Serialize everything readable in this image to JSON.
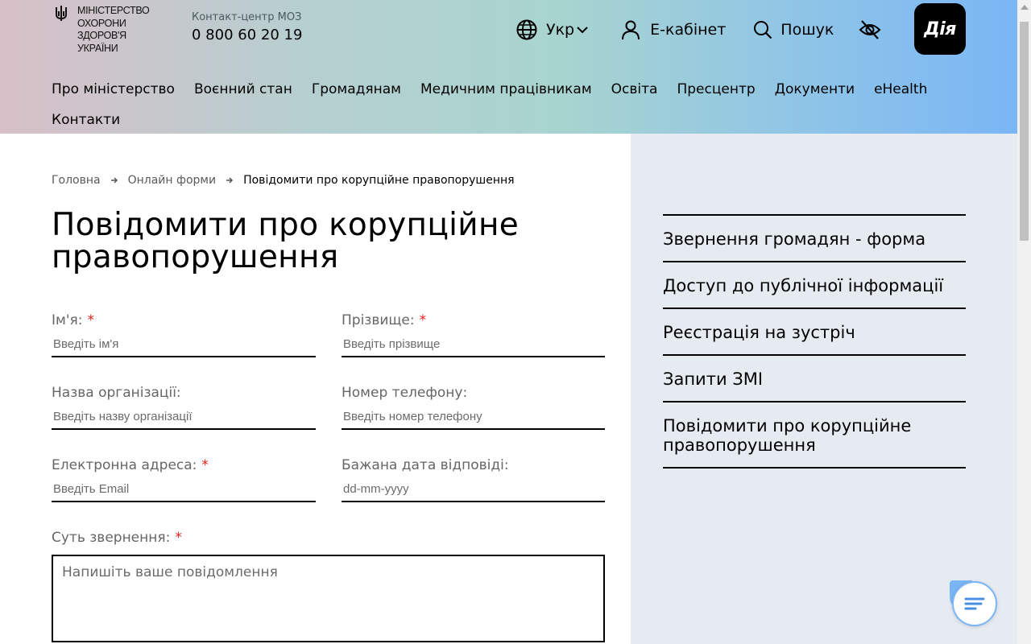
{
  "header": {
    "logo_lines": [
      "Міністерство",
      "охорони",
      "здоров'я",
      "України"
    ],
    "contact_label": "Контакт-центр МОЗ",
    "contact_phone": "0 800 60 20 19",
    "language_label": "Укр",
    "cabinet_label": "Е-кабінет",
    "search_label": "Пошук",
    "diia_label": "Дія",
    "icons": [
      "trident-icon",
      "globe-icon",
      "chevron-down-icon",
      "user-icon",
      "search-icon",
      "eye-off-icon"
    ],
    "gradient_colors": [
      "#d8c0c8",
      "#a8d4cf",
      "#7ab6f5"
    ]
  },
  "nav": {
    "items": [
      "Про міністерство",
      "Воєнний стан",
      "Громадянам",
      "Медичним працівникам",
      "Освіта",
      "Пресцентр",
      "Документи",
      "eHealth",
      "Контакти"
    ]
  },
  "breadcrumb": {
    "home": "Головна",
    "forms": "Онлайн форми",
    "current": "Повідомити про корупційне правопорушення"
  },
  "page": {
    "title": "Повідомити про корупційне правопорушення"
  },
  "form": {
    "required_mark": "*",
    "name_label": "Ім'я:",
    "name_placeholder": "Введіть ім'я",
    "surname_label": "Прізвище:",
    "surname_placeholder": "Введіть прізвище",
    "org_label": "Назва організації:",
    "org_placeholder": "Введіть назву організації",
    "phone_label": "Номер телефону:",
    "phone_placeholder": "Введіть номер телефону",
    "email_label": "Електронна адреса:",
    "email_placeholder": "Введіть Email",
    "date_label": "Бажана дата відповіді:",
    "date_placeholder": "dd-mm-yyyy",
    "message_label": "Суть звернення:",
    "message_placeholder": "Напишіть ваше повідомлення"
  },
  "sidebar": {
    "items": [
      "Звернення громадян - форма",
      "Доступ до публічної інформації",
      "Реєстрація на зустріч",
      "Запити ЗМІ",
      "Повідомити про корупційне правопорушення"
    ]
  },
  "colors": {
    "required": "#e0201b",
    "sidebar_bg": "#e5ebf1",
    "chat_accent": "#7ab6f5"
  }
}
